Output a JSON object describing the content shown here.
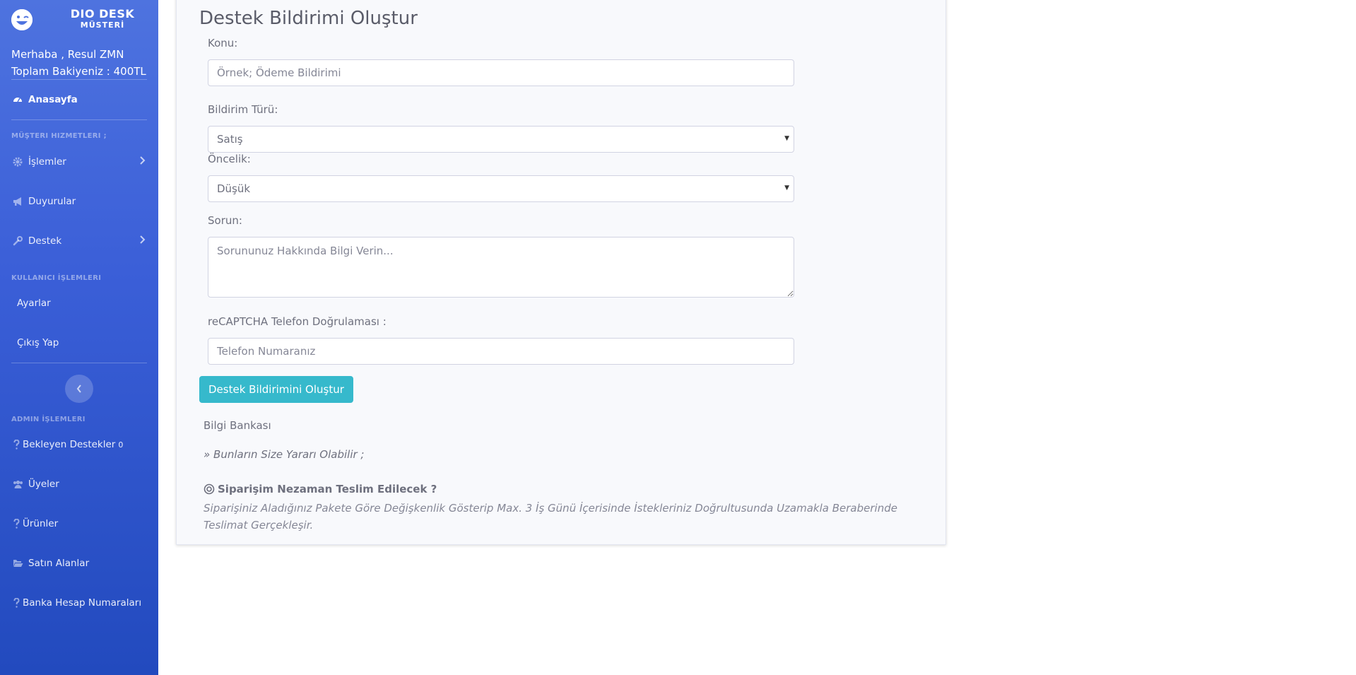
{
  "brand": {
    "title": "DIO DESK",
    "subtitle": "MÜSTERİ"
  },
  "user": {
    "greeting": "Merhaba , Resul ZMN",
    "balance": "Toplam Bakiyeniz : 400TL"
  },
  "sidebar": {
    "home": "Anasayfa",
    "section_customer": "MÜŞTERI HIZMETLERI ;",
    "islemler": "İşlemler",
    "duyurular": "Duyurular",
    "destek": "Destek",
    "section_user": "KULLANICI İŞLEMLERI",
    "ayarlar": "Ayarlar",
    "cikis": "Çıkış Yap",
    "section_admin": "ADMIN İŞLEMLERI",
    "bekleyen": "Bekleyen Destekler",
    "bekleyen_count": "0",
    "uyeler": "Üyeler",
    "urunler": "Ürünler",
    "satin_alanlar": "Satın Alanlar",
    "banka": "Banka Hesap Numaraları"
  },
  "form": {
    "title": "Destek Bildirimi Oluştur",
    "konu_label": "Konu:",
    "konu_placeholder": "Örnek; Ödeme Bildirimi",
    "tur_label": "Bildirim Türü:",
    "tur_value": "Satış",
    "oncelik_label": "Öncelik:",
    "oncelik_value": "Düşük",
    "sorun_label": "Sorun:",
    "sorun_placeholder": "Sorununuz Hakkında Bilgi Verin...",
    "captcha_label": "reCAPTCHA Telefon Doğrulaması :",
    "phone_placeholder": "Telefon Numaranız",
    "submit": "Destek Bildirimini Oluştur"
  },
  "kb": {
    "title": "Bilgi Bankası",
    "hint": "» Bunların Size Yararı Olabilir ;",
    "question": "Siparişim Nezaman Teslim Edilecek ?",
    "answer": "Siparişiniz Aladığınız Pakete Göre Değişkenlik Gösterip Max. 3 İş Günü İçerisinde İstekleriniz Doğrultusunda Uzamakla Beraberinde Teslimat Gerçekleşir."
  }
}
